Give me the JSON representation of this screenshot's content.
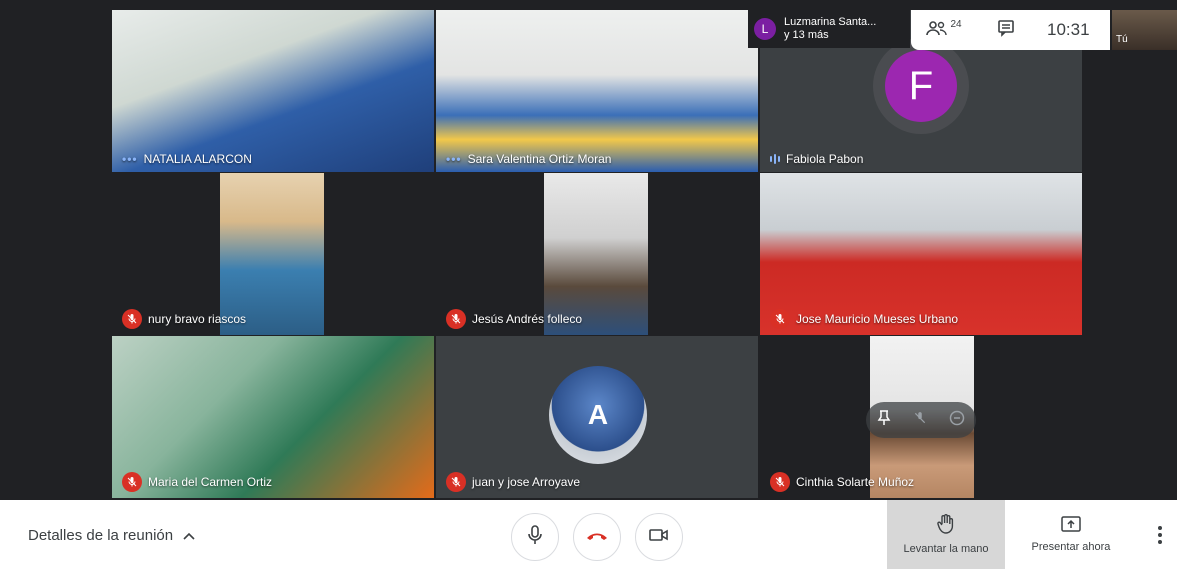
{
  "participants_chip": {
    "initial": "L",
    "line1": "Luzmarina Santa...",
    "line2": "y 13 más"
  },
  "top_bar": {
    "participant_count": "24",
    "time": "10:31"
  },
  "self_view": {
    "label": "Tú"
  },
  "tiles": [
    {
      "name": "NATALIA ALARCON",
      "status": "speaking-dots"
    },
    {
      "name": "Sara Valentina Ortiz Moran",
      "status": "speaking-dots"
    },
    {
      "name": "Fabiola Pabon",
      "status": "speaking-bars",
      "avatar_initial": "F",
      "avatar_color": "#9c27b0"
    },
    {
      "name": "nury bravo riascos",
      "status": "muted"
    },
    {
      "name": "Jesús Andrés folleco",
      "status": "muted"
    },
    {
      "name": "Jose Mauricio Mueses Urbano",
      "status": "muted"
    },
    {
      "name": "Maria del Carmen Ortiz",
      "status": "muted"
    },
    {
      "name": "juan y jose Arroyave",
      "status": "muted"
    },
    {
      "name": "Cinthia Solarte Muñoz",
      "status": "muted"
    }
  ],
  "bottom_bar": {
    "details_label": "Detalles de la reunión",
    "raise_hand_label": "Levantar la mano",
    "present_label": "Presentar ahora"
  },
  "colors": {
    "mute_red": "#d93025",
    "hangup_red": "#d93025",
    "avatar_purple": "#9c27b0",
    "accent_blue": "#8ab4f8"
  }
}
